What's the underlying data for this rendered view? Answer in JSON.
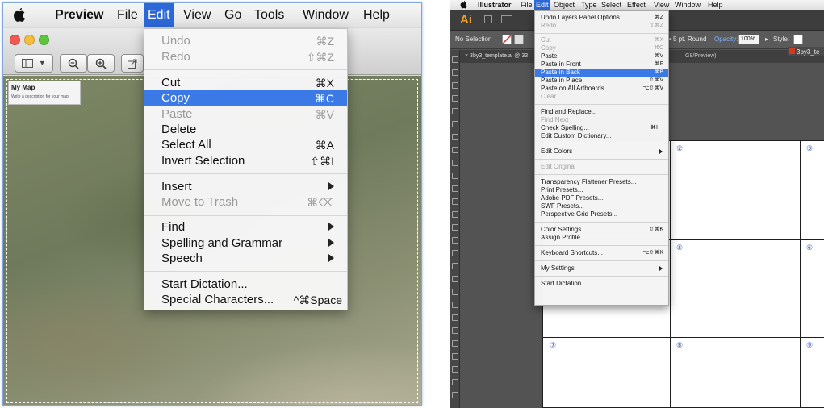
{
  "preview": {
    "menubar": {
      "app_name": "Preview",
      "items": [
        "File",
        "Edit",
        "View",
        "Go",
        "Tools",
        "Window",
        "Help"
      ],
      "active": "Edit"
    },
    "toolbar": {
      "zoom_out": "−",
      "zoom_in": "+"
    },
    "map_card": {
      "title": "My Map",
      "description": "Write a description for your map."
    },
    "edit_menu": {
      "undo": {
        "label": "Undo",
        "shortcut": "⌘Z"
      },
      "redo": {
        "label": "Redo",
        "shortcut": "⇧⌘Z"
      },
      "cut": {
        "label": "Cut",
        "shortcut": "⌘X"
      },
      "copy": {
        "label": "Copy",
        "shortcut": "⌘C"
      },
      "paste": {
        "label": "Paste",
        "shortcut": "⌘V"
      },
      "delete": {
        "label": "Delete"
      },
      "select_all": {
        "label": "Select All",
        "shortcut": "⌘A"
      },
      "invert_selection": {
        "label": "Invert Selection",
        "shortcut": "⇧⌘I"
      },
      "insert": {
        "label": "Insert"
      },
      "move_to_trash": {
        "label": "Move to Trash",
        "shortcut": "⌘⌫"
      },
      "find": {
        "label": "Find"
      },
      "spelling_grammar": {
        "label": "Spelling and Grammar"
      },
      "speech": {
        "label": "Speech"
      },
      "start_dictation": {
        "label": "Start Dictation..."
      },
      "special_characters": {
        "label": "Special Characters...",
        "shortcut": "^⌘Space"
      }
    }
  },
  "illustrator": {
    "menubar": {
      "app_name": "Illustrator",
      "items": [
        "File",
        "Edit",
        "Object",
        "Type",
        "Select",
        "Effect",
        "View",
        "Window",
        "Help"
      ],
      "active": "Edit"
    },
    "logo": "Ai",
    "control_bar": {
      "selection": "No Selection",
      "stroke": "5 pt. Round",
      "opacity_label": "Opacity:",
      "opacity_value": "100%",
      "style_label": "Style:"
    },
    "document": {
      "tab_title": "3by3_template.ai @ 33",
      "tab_suffix": "G8/Preview)",
      "doc_name": "3by3_te"
    },
    "grid_numbers": [
      "②",
      "③",
      "⑤",
      "⑥",
      "⑦",
      "⑧",
      "⑨"
    ],
    "edit_menu": {
      "undo_layers": {
        "label": "Undo Layers Panel Options",
        "shortcut": "⌘Z"
      },
      "redo": {
        "label": "Redo",
        "shortcut": "⇧⌘Z"
      },
      "cut": {
        "label": "Cut",
        "shortcut": "⌘X"
      },
      "copy": {
        "label": "Copy",
        "shortcut": "⌘C"
      },
      "paste": {
        "label": "Paste",
        "shortcut": "⌘V"
      },
      "paste_in_front": {
        "label": "Paste in Front",
        "shortcut": "⌘F"
      },
      "paste_in_back": {
        "label": "Paste in Back",
        "shortcut": "⌘B"
      },
      "paste_in_place": {
        "label": "Paste in Place",
        "shortcut": "⇧⌘V"
      },
      "paste_on_all_artboards": {
        "label": "Paste on All Artboards",
        "shortcut": "⌥⇧⌘V"
      },
      "clear": {
        "label": "Clear"
      },
      "find_replace": {
        "label": "Find and Replace..."
      },
      "find_next": {
        "label": "Find Next"
      },
      "check_spelling": {
        "label": "Check Spelling...",
        "shortcut": "⌘I"
      },
      "edit_custom_dictionary": {
        "label": "Edit Custom Dictionary..."
      },
      "edit_colors": {
        "label": "Edit Colors"
      },
      "edit_original": {
        "label": "Edit Original"
      },
      "transparency_flattener": {
        "label": "Transparency Flattener Presets..."
      },
      "print_presets": {
        "label": "Print Presets..."
      },
      "adobe_pdf_presets": {
        "label": "Adobe PDF Presets..."
      },
      "swf_presets": {
        "label": "SWF Presets..."
      },
      "perspective_grid_presets": {
        "label": "Perspective Grid Presets..."
      },
      "color_settings": {
        "label": "Color Settings...",
        "shortcut": "⇧⌘K"
      },
      "assign_profile": {
        "label": "Assign Profile..."
      },
      "keyboard_shortcuts": {
        "label": "Keyboard Shortcuts...",
        "shortcut": "⌥⇧⌘K"
      },
      "my_settings": {
        "label": "My Settings"
      },
      "start_dictation": {
        "label": "Start Dictation..."
      }
    }
  },
  "colors": {
    "menu_highlight": "#3b79e7",
    "mac_menu_active": "#2c68d8",
    "ai_brand": "#f09d2d"
  }
}
